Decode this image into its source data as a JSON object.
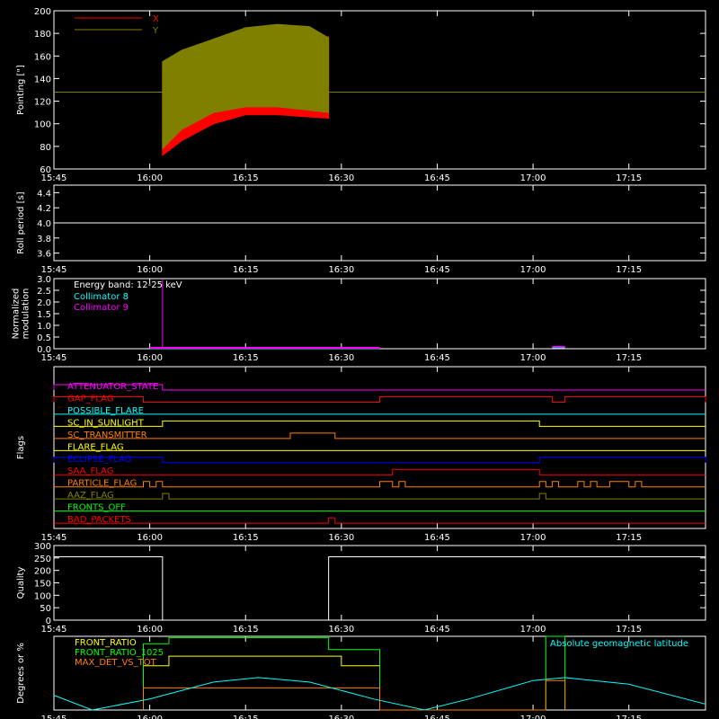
{
  "x_axis": {
    "start": "15:45",
    "end": "17:27",
    "ticks": [
      "15:45",
      "16:00",
      "16:15",
      "16:30",
      "16:45",
      "17:00",
      "17:15"
    ]
  },
  "colors": {
    "background": "#000000",
    "axes": "#ffffff",
    "x": "#ff0000",
    "y": "#808000",
    "white": "#ffffff",
    "cyan": "#00ffff",
    "magenta": "#ff00ff",
    "yellow": "#ffff00",
    "green": "#00ff00",
    "orange": "#ff8000",
    "blue": "#0000ff",
    "red": "#ff0000"
  },
  "chart_data": [
    {
      "type": "area",
      "ylabel": "Pointing [\"]",
      "ylim": [
        60,
        200
      ],
      "yticks": [
        "60",
        "80",
        "100",
        "120",
        "140",
        "160",
        "180",
        "200"
      ],
      "legend_position": "top-left",
      "series": [
        {
          "name": "X",
          "color": "#ff0000",
          "x": [
            "16:02",
            "16:05",
            "16:10",
            "16:15",
            "16:20",
            "16:25",
            "16:28"
          ],
          "min": [
            72,
            85,
            100,
            108,
            108,
            106,
            105
          ],
          "max": [
            150,
            158,
            168,
            175,
            178,
            177,
            177
          ]
        },
        {
          "name": "Y",
          "color": "#808000",
          "x": [
            "16:02",
            "16:05",
            "16:10",
            "16:15",
            "16:20",
            "16:25",
            "16:28"
          ],
          "min": [
            78,
            95,
            110,
            115,
            115,
            112,
            110
          ],
          "max": [
            155,
            165,
            175,
            185,
            188,
            186,
            176
          ]
        }
      ],
      "reference_y": 128
    },
    {
      "type": "line",
      "ylabel": "Roll period [s]",
      "ylim": [
        3.5,
        4.5
      ],
      "yticks": [
        "3.6",
        "3.8",
        "4.0",
        "4.2",
        "4.4"
      ],
      "series": [
        {
          "color": "#ffffff",
          "x": [
            "15:45",
            "17:27"
          ],
          "y": [
            4.0,
            4.0
          ]
        }
      ]
    },
    {
      "type": "line",
      "ylabel": "Normalized\nmodulation",
      "ylim": [
        0,
        3
      ],
      "yticks": [
        "0.0",
        "0.5",
        "1.0",
        "1.5",
        "2.0",
        "2.5",
        "3.0"
      ],
      "legend_title": "Energy band: 12-25 keV",
      "series": [
        {
          "name": "Collimator 8",
          "color": "#00ffff",
          "segments": [
            {
              "x": [
                "16:00",
                "16:36"
              ],
              "y": [
                0.02,
                0.02
              ]
            },
            {
              "x": [
                "17:03",
                "17:05"
              ],
              "y": [
                0.05,
                0.05
              ]
            }
          ]
        },
        {
          "name": "Collimator 9",
          "color": "#ff00ff",
          "segments": [
            {
              "x": [
                "16:00",
                "16:36"
              ],
              "y": [
                0.04,
                0.04
              ]
            },
            {
              "x": [
                "17:03",
                "17:05"
              ],
              "y": [
                0.08,
                0.08
              ]
            }
          ],
          "spike": {
            "x": "16:02",
            "y": 2.95
          }
        }
      ]
    },
    {
      "type": "line",
      "ylabel": "Flags",
      "flags": [
        {
          "label": "ATTENUATOR_STATE",
          "color": "#ff00ff",
          "on": [
            [
              "15:45",
              "16:02"
            ]
          ]
        },
        {
          "label": "GAP_FLAG",
          "color": "#ff0000",
          "on": [
            [
              "15:45",
              "15:59"
            ],
            [
              "16:36",
              "17:03"
            ],
            [
              "17:05",
              "17:27"
            ]
          ]
        },
        {
          "label": "POSSIBLE_FLARE",
          "color": "#00ffff",
          "on": []
        },
        {
          "label": "SC_IN_SUNLIGHT",
          "color": "#ffff00",
          "on": [
            [
              "16:02",
              "17:01"
            ]
          ]
        },
        {
          "label": "SC_TRANSMITTER",
          "color": "#ff8000",
          "on": [
            [
              "16:22",
              "16:29"
            ]
          ]
        },
        {
          "label": "FLARE_FLAG",
          "color": "#ffff00",
          "on": []
        },
        {
          "label": "ECLIPSE_FLAG",
          "color": "#0000ff",
          "on": [
            [
              "15:45",
              "16:02"
            ],
            [
              "17:01",
              "17:27"
            ]
          ]
        },
        {
          "label": "SAA_FLAG",
          "color": "#ff0000",
          "on": [
            [
              "16:38",
              "17:01"
            ]
          ]
        },
        {
          "label": "PARTICLE_FLAG",
          "color": "#ff8000",
          "on": [
            [
              "15:59",
              "16:00"
            ],
            [
              "16:01",
              "16:02"
            ],
            [
              "16:36",
              "16:38"
            ],
            [
              "16:39",
              "16:40"
            ],
            [
              "17:01",
              "17:02"
            ],
            [
              "17:03",
              "17:04"
            ],
            [
              "17:07",
              "17:08"
            ],
            [
              "17:09",
              "17:10"
            ],
            [
              "17:12",
              "17:15"
            ],
            [
              "17:16",
              "17:17"
            ]
          ]
        },
        {
          "label": "AAZ_FLAG",
          "color": "#808000",
          "on": [
            [
              "16:02",
              "16:03"
            ],
            [
              "17:01",
              "17:02"
            ]
          ]
        },
        {
          "label": "FRONTS_OFF",
          "color": "#00ff00",
          "on": []
        },
        {
          "label": "BAD_PACKETS",
          "color": "#ff0000",
          "on": [
            [
              "16:28",
              "16:29"
            ]
          ]
        }
      ]
    },
    {
      "type": "line",
      "ylabel": "Quality",
      "ylim": [
        0,
        300
      ],
      "yticks": [
        "0",
        "50",
        "100",
        "150",
        "200",
        "250",
        "300"
      ],
      "series": [
        {
          "color": "#ffffff",
          "x": [
            "15:45",
            "16:02",
            "16:02",
            "16:28",
            "16:28",
            "17:27"
          ],
          "y": [
            255,
            255,
            0,
            0,
            255,
            255
          ]
        }
      ]
    },
    {
      "type": "line",
      "ylabel": "Degrees or %",
      "ylim": [
        0,
        100
      ],
      "legend_position": "top-left",
      "annotation": "Absolute geomagnetic latitude",
      "series": [
        {
          "name": "FRONT_RATIO",
          "color": "#ffff00",
          "x": [
            "15:59",
            "15:59",
            "16:03",
            "16:03",
            "16:30",
            "16:30",
            "16:36",
            "16:36"
          ],
          "y": [
            0,
            60,
            60,
            73,
            73,
            60,
            60,
            0
          ]
        },
        {
          "name": "FRONT_RATIO_1025",
          "color": "#00ff00",
          "x": [
            "15:59",
            "15:59",
            "16:03",
            "16:03",
            "16:28",
            "16:28",
            "16:36",
            "16:36",
            "17:02",
            "17:02",
            "17:05",
            "17:05"
          ],
          "y": [
            0,
            90,
            90,
            98,
            98,
            82,
            82,
            0,
            0,
            100,
            100,
            0
          ]
        },
        {
          "name": "MAX_DET_VS_TOT",
          "color": "#ff8000",
          "x": [
            "15:59",
            "15:59",
            "16:36",
            "16:36",
            "17:02",
            "17:02",
            "17:05",
            "17:05"
          ],
          "y": [
            0,
            30,
            30,
            0,
            0,
            40,
            40,
            0
          ]
        },
        {
          "name": "Absolute geomagnetic latitude",
          "color": "#00ffff",
          "x": [
            "15:45",
            "15:51",
            "16:00",
            "16:10",
            "16:17",
            "16:25",
            "16:35",
            "16:43",
            "16:50",
            "17:00",
            "17:05",
            "17:15",
            "17:27"
          ],
          "y": [
            20,
            0,
            15,
            38,
            44,
            38,
            15,
            0,
            15,
            40,
            44,
            35,
            8
          ]
        }
      ]
    }
  ]
}
